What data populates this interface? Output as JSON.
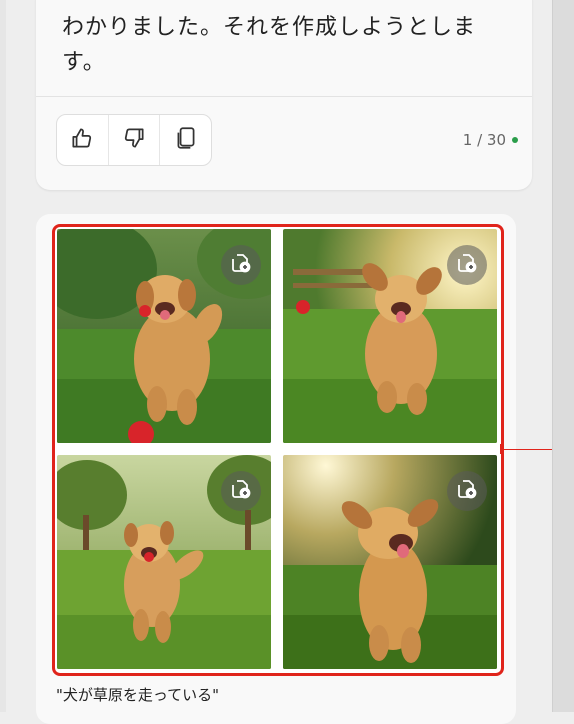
{
  "chat": {
    "assistant_message": "わかりました。それを作成しようとします。",
    "message_line_1": "わかりました。それを作成しようとしま",
    "message_line_2": "す。",
    "feedback": {
      "like_icon": "thumbs-up-icon",
      "dislike_icon": "thumbs-down-icon",
      "copy_icon": "copy-icon"
    },
    "turn_counter": "1 / 30",
    "status_color": "#2a9d4a"
  },
  "image_result": {
    "images": [
      {
        "icon": "save-to-collection-icon"
      },
      {
        "icon": "save-to-collection-icon"
      },
      {
        "icon": "save-to-collection-icon"
      },
      {
        "icon": "save-to-collection-icon"
      }
    ],
    "prompt_caption": "\"犬が草原を走っている\"",
    "highlight_color": "#e0241b"
  }
}
